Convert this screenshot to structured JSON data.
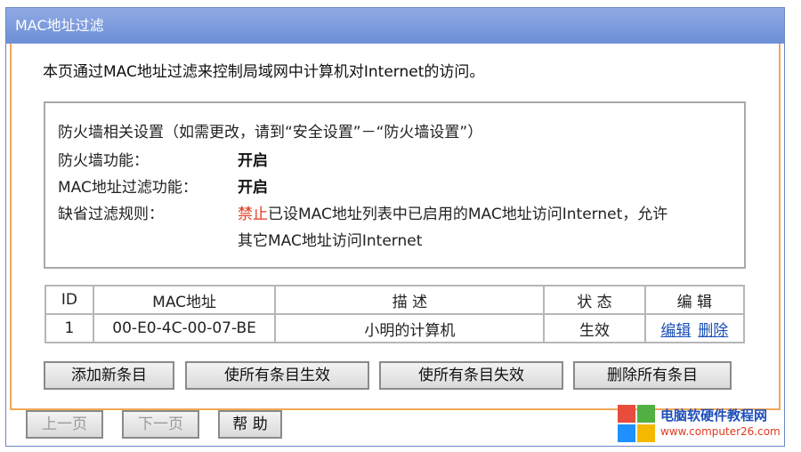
{
  "window": {
    "title": "MAC地址过滤"
  },
  "intro": "本页通过MAC地址过滤来控制局域网中计算机对Internet的访问。",
  "firewall": {
    "heading": "防火墙相关设置（如需更改，请到“安全设置”－“防火墙设置”）",
    "rows": [
      {
        "label": "防火墙功能：",
        "value": "开启"
      },
      {
        "label": "MAC地址过滤功能：",
        "value": "开启"
      }
    ],
    "default_rule_label": "缺省过滤规则：",
    "default_rule_highlight": "禁止",
    "default_rule_text1": "已设MAC地址列表中已启用的MAC地址访问Internet，允许",
    "default_rule_text2": "其它MAC地址访问Internet"
  },
  "table": {
    "headers": [
      "ID",
      "MAC地址",
      "描 述",
      "状 态",
      "编 辑"
    ],
    "rows": [
      {
        "id": "1",
        "mac": "00-E0-4C-00-07-BE",
        "desc": "小明的计算机",
        "status": "生效",
        "edit": "编辑",
        "delete": "删除"
      }
    ]
  },
  "buttons": {
    "add": "添加新条目",
    "enable_all": "使所有条目生效",
    "disable_all": "使所有条目失效",
    "delete_all": "删除所有条目",
    "prev": "上一页",
    "next": "下一页",
    "help": "帮 助"
  },
  "watermark": {
    "line1": "电脑软硬件教程网",
    "line2": "www.computer26.com"
  }
}
